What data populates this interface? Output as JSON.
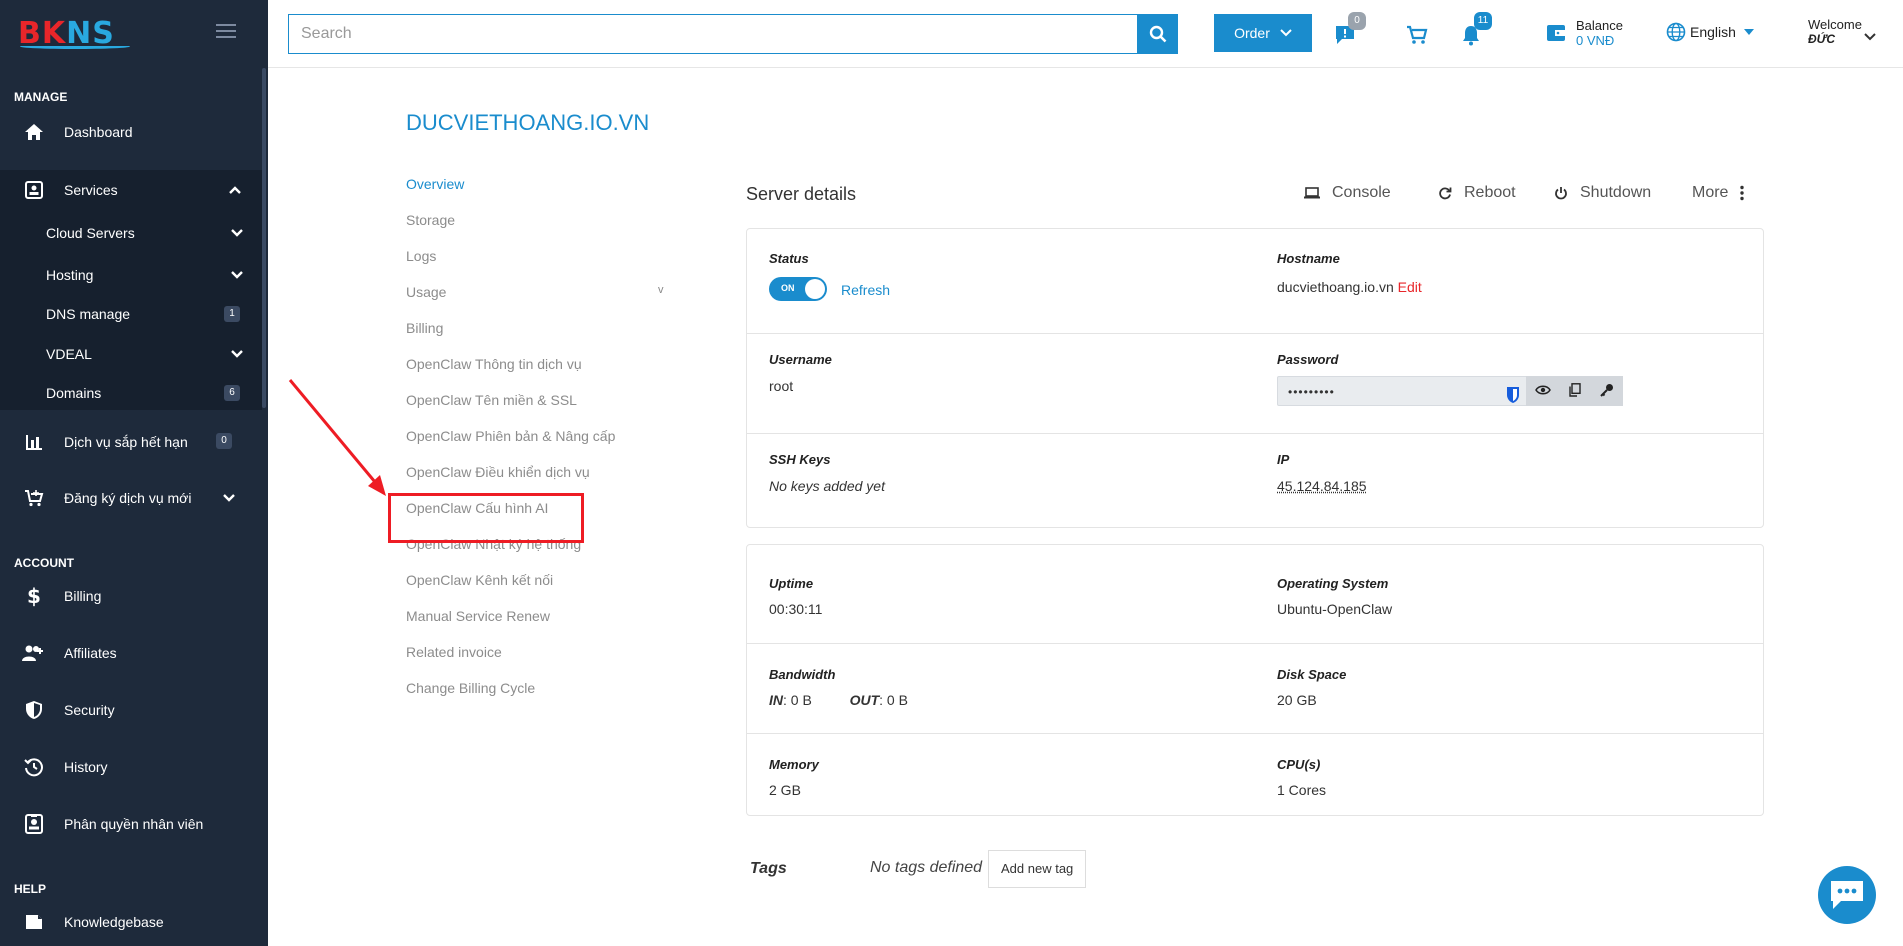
{
  "brand": {
    "logo_b": "BK",
    "logo_ns": "NS"
  },
  "sidebar": {
    "manage_label": "MANAGE",
    "account_label": "ACCOUNT",
    "help_label": "HELP",
    "dashboard": "Dashboard",
    "services": "Services",
    "cloud_servers": "Cloud Servers",
    "hosting": "Hosting",
    "dns_manage": "DNS manage",
    "dns_count": "1",
    "vdeal": "VDEAL",
    "domains": "Domains",
    "domains_count": "6",
    "expiring": "Dịch vụ sắp hết hạn",
    "expiring_count": "0",
    "register_new": "Đăng ký dịch vụ mới",
    "billing": "Billing",
    "affiliates": "Affiliates",
    "security": "Security",
    "history": "History",
    "staff_perm": "Phân quyền nhân viên",
    "knowledgebase": "Knowledgebase"
  },
  "header": {
    "search_placeholder": "Search",
    "order_label": "Order",
    "tickets_badge": "0",
    "notifications_badge": "11",
    "balance_label": "Balance",
    "balance_value": "0 VNĐ",
    "language": "English",
    "welcome": "Welcome",
    "user_name": "ĐỨC",
    "colors": {
      "accent": "#1a8ccd",
      "tickets_badge": "#9aa3ad",
      "notif_badge": "#1a8ccd"
    }
  },
  "main": {
    "service_title": "DUCVIETHOANG.IO.VN",
    "menu": [
      {
        "label": "Overview"
      },
      {
        "label": "Storage"
      },
      {
        "label": "Logs"
      },
      {
        "label": "Usage"
      },
      {
        "label": "Billing"
      },
      {
        "label": "OpenClaw Thông tin dịch vụ"
      },
      {
        "label": "OpenClaw Tên miền & SSL"
      },
      {
        "label": "OpenClaw Phiên bản & Nâng cấp"
      },
      {
        "label": "OpenClaw Điều khiển dịch vụ"
      },
      {
        "label": "OpenClaw Cấu hình AI"
      },
      {
        "label": "OpenClaw Nhật ký hệ thống"
      },
      {
        "label": "OpenClaw Kênh kết nối"
      },
      {
        "label": "Manual Service Renew"
      },
      {
        "label": "Related invoice"
      },
      {
        "label": "Change Billing Cycle"
      }
    ],
    "usage_chevron": "v",
    "server_details_title": "Server details",
    "actions": {
      "console": "Console",
      "reboot": "Reboot",
      "shutdown": "Shutdown",
      "more": "More"
    },
    "status_label": "Status",
    "status_toggle": "ON",
    "refresh": "Refresh",
    "hostname_label": "Hostname",
    "hostname_value": "ducviethoang.io.vn",
    "edit": "Edit",
    "username_label": "Username",
    "username_value": "root",
    "password_label": "Password",
    "password_mask": "•••••••••",
    "ssh_label": "SSH Keys",
    "ssh_value": "No keys added yet",
    "ip_label": "IP",
    "ip_value": "45.124.84.185",
    "uptime_label": "Uptime",
    "uptime_value": "00:30:11",
    "os_label": "Operating System",
    "os_value": "Ubuntu-OpenClaw",
    "bandwidth_label": "Bandwidth",
    "bw_in_label": "IN",
    "bw_in_value": ": 0 B",
    "bw_out_label": "OUT",
    "bw_out_value": ": 0 B",
    "disk_label": "Disk Space",
    "disk_value": "20 GB",
    "memory_label": "Memory",
    "memory_value": "2 GB",
    "cpu_label": "CPU(s)",
    "cpu_value": "1 Cores",
    "tags_label": "Tags",
    "tags_none": "No tags defined",
    "tags_add": "Add new tag"
  }
}
